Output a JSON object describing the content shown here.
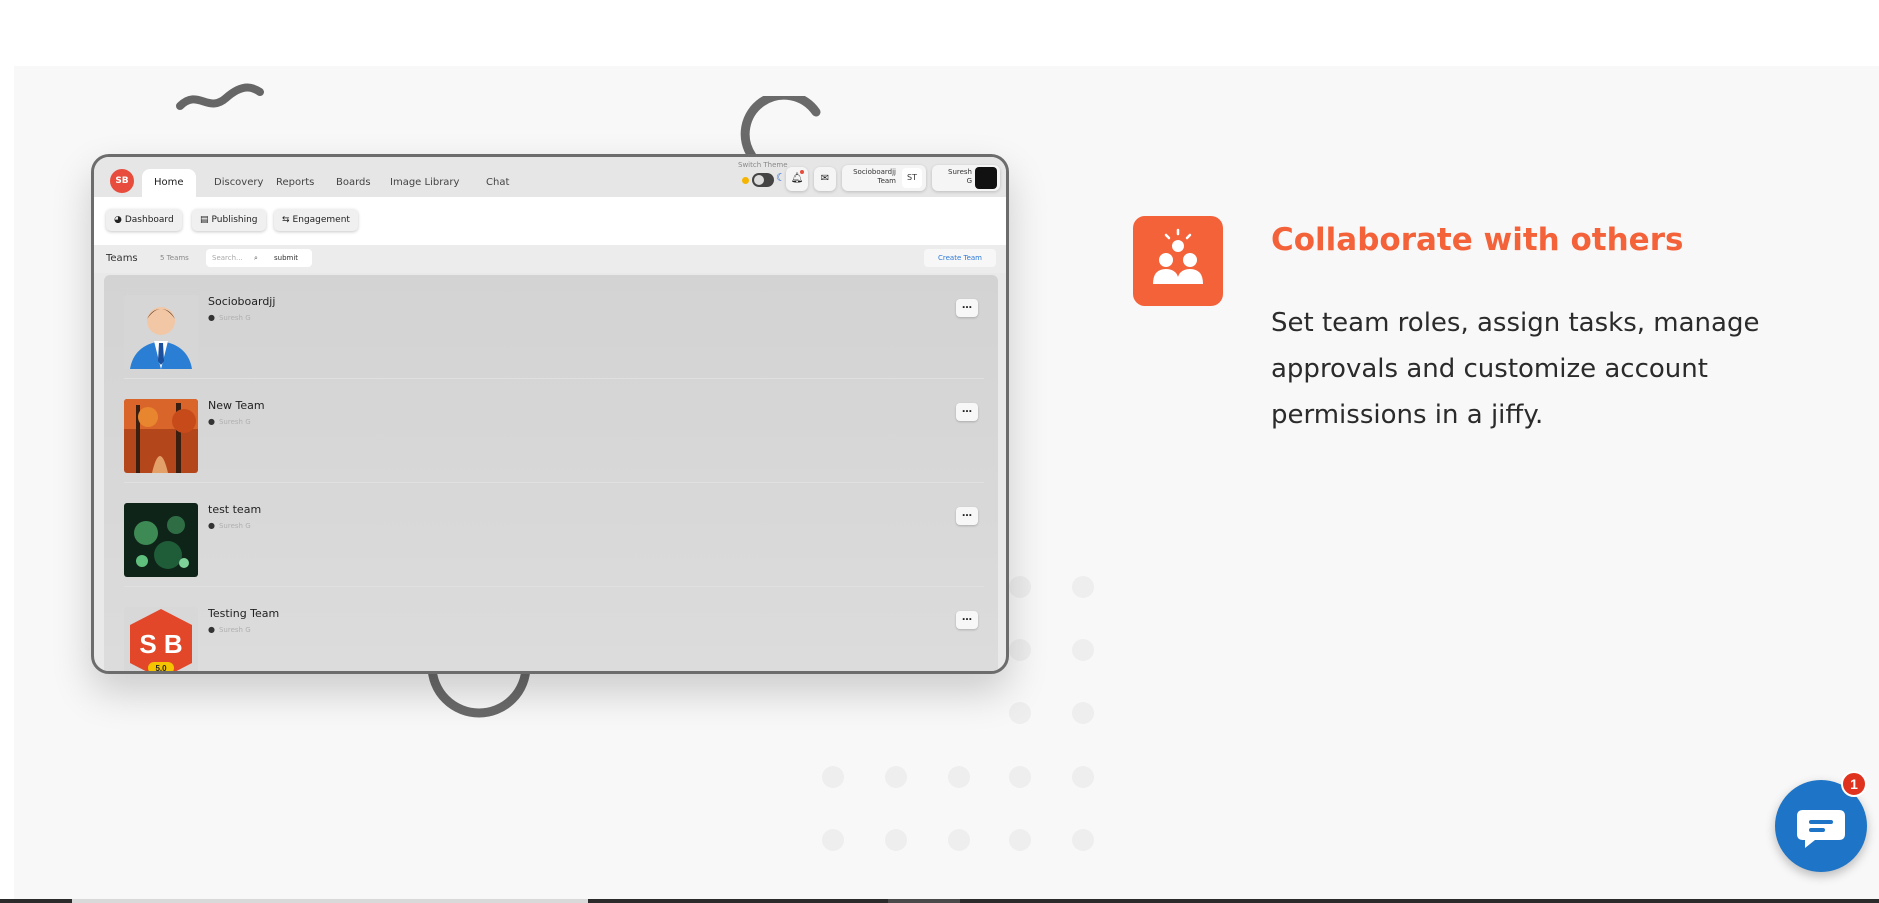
{
  "mockup": {
    "logo": "SB",
    "tabs": [
      "Home",
      "Discovery",
      "Reports",
      "Boards",
      "Image Library",
      "Chat"
    ],
    "switch_theme_label": "Switch Theme",
    "team_block": {
      "line1": "Socioboardjj",
      "line2": "Team",
      "badge": "ST"
    },
    "user_block": {
      "line1": "Suresh",
      "line2": "G"
    },
    "sub_buttons": [
      "Dashboard",
      "Publishing",
      "Engagement"
    ],
    "teams_bar": {
      "title": "Teams",
      "count": "5 Teams",
      "search_placeholder": "Search...",
      "submit": "submit",
      "create": "Create Team"
    },
    "teams": [
      {
        "name": "Socioboardjj",
        "owner": "Suresh G",
        "avatar": "person-avatar"
      },
      {
        "name": "New Team",
        "owner": "Suresh G",
        "avatar": "autumn-forest"
      },
      {
        "name": "test team",
        "owner": "Suresh G",
        "avatar": "green-fantasy"
      },
      {
        "name": "Testing Team",
        "owner": "Suresh G",
        "avatar": "sb-logo"
      }
    ],
    "sb_logo_version": "5.0"
  },
  "feature": {
    "icon": "team-collaboration-icon",
    "title": "Collaborate with others",
    "description": "Set team roles, assign tasks, manage approvals and customize account permissions in a jiffy."
  },
  "chat_widget": {
    "icon": "chat-bubble-icon",
    "badge": "1"
  },
  "colors": {
    "accent": "#f4623a",
    "chat": "#1e74c6",
    "badge": "#e0331f"
  }
}
